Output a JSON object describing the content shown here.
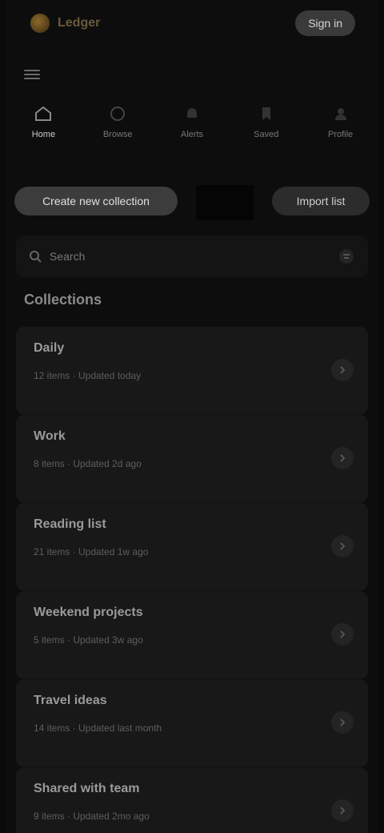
{
  "header": {
    "brand": "Ledger",
    "action_label": "Sign in"
  },
  "nav": {
    "items": [
      {
        "label": "Home",
        "active": true
      },
      {
        "label": "Browse",
        "active": false
      },
      {
        "label": "Alerts",
        "active": false
      },
      {
        "label": "Saved",
        "active": false
      },
      {
        "label": "Profile",
        "active": false
      }
    ]
  },
  "actions": {
    "primary_label": "Create new collection",
    "secondary_label": "Import list"
  },
  "search": {
    "placeholder": "Search",
    "value": ""
  },
  "section": {
    "title": "Collections"
  },
  "collections": [
    {
      "name": "Daily",
      "meta": "12 items · Updated today"
    },
    {
      "name": "Work",
      "meta": "8 items · Updated 2d ago"
    },
    {
      "name": "Reading list",
      "meta": "21 items · Updated 1w ago"
    },
    {
      "name": "Weekend projects",
      "meta": "5 items · Updated 3w ago"
    },
    {
      "name": "Travel ideas",
      "meta": "14 items · Updated last month"
    },
    {
      "name": "Shared with team",
      "meta": "9 items · Updated 2mo ago"
    }
  ],
  "colors": {
    "background": "#0d0d0d",
    "card": "#181818",
    "accent": "#8a6a2a"
  }
}
